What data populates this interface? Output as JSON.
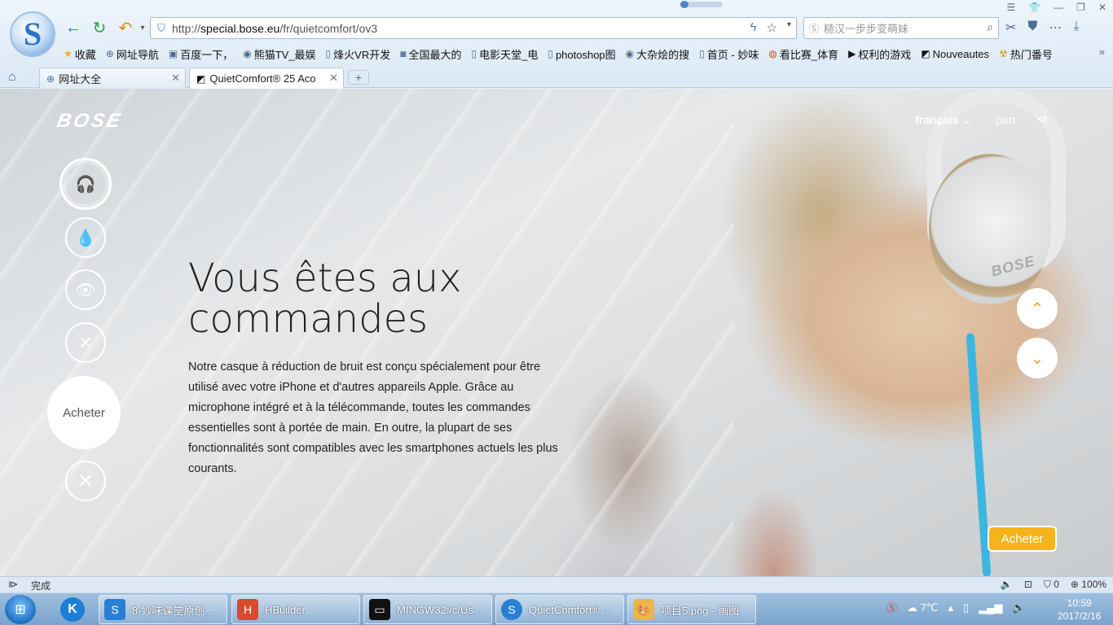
{
  "browser": {
    "logo_letter": "S",
    "url_pre": "http://",
    "url_host": "special.bose.eu",
    "url_post": "/fr/quietcomfort/ov3",
    "search_placeholder": "糙汉一步步变萌妹",
    "bookmarks": [
      "收藏",
      "网址导航",
      "百度一下，",
      "熊猫TV_最娱",
      "烽火VR开发",
      "全国最大的",
      "电影天堂_电",
      "photoshop图",
      "大杂烩的搜",
      "首页 - 妙味",
      "看比赛_体育",
      "权利的游戏",
      "Nouveautes",
      "热门番号"
    ],
    "tabs": [
      {
        "label": "网址大全"
      },
      {
        "label": "QuietComfort® 25 Acou"
      }
    ]
  },
  "page": {
    "brand": "BOSE",
    "language": "français",
    "part_label": "part",
    "side_buy_label": "Acheter",
    "headline_line1": "Vous êtes aux",
    "headline_line2": "commandes",
    "body": "Notre casque à réduction de bruit est conçu spécialement pour être utilisé avec votre iPhone et d'autres appareils Apple. Grâce au microphone intégré et à la télécommande, toutes les commandes essentielles sont à portée de main. En outre, la plupart de ses fonctionnalités sont compatibles avec les smartphones actuels les plus courants.",
    "buy_button": "Acheter",
    "cup_brand": "BOSE"
  },
  "status": {
    "text": "完成",
    "count": "0",
    "zoom": "100%"
  },
  "taskbar": {
    "k_label": "K",
    "tasks": [
      {
        "label": "8-妙味课堂原创..."
      },
      {
        "label": "HBuilder"
      },
      {
        "label": "MINGW32:/c/Us..."
      },
      {
        "label": "QuietComfort® ..."
      },
      {
        "label": "项目5.png - 画图"
      }
    ],
    "temp": "7℃",
    "time": "10:59",
    "date": "2017/2/16"
  }
}
